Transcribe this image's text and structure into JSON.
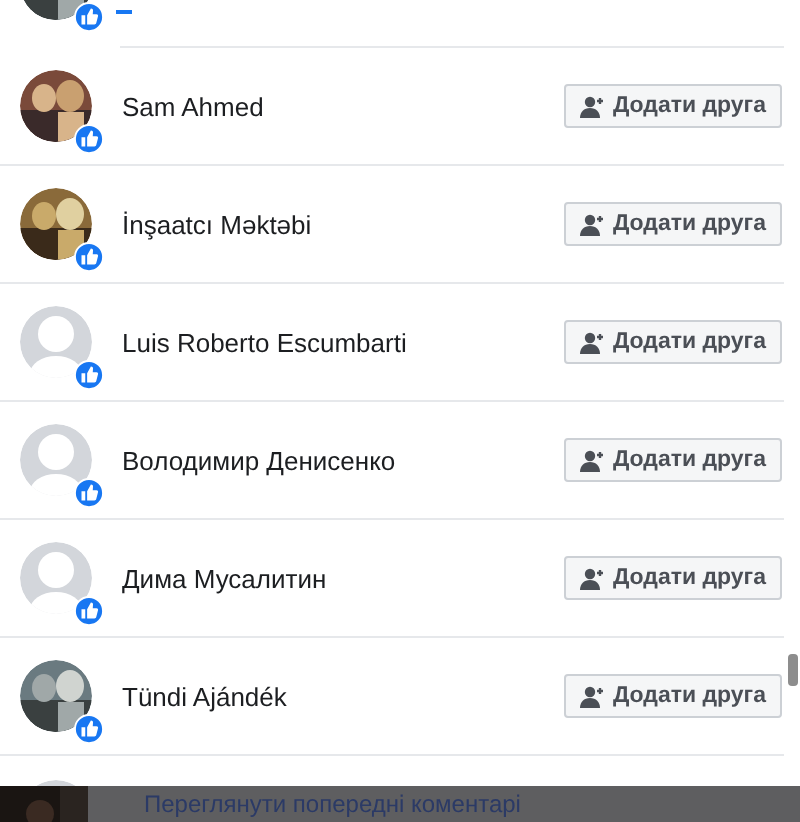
{
  "people": [
    {
      "name": "Sam Ahmed",
      "kind": "picture",
      "button": "Додати друга"
    },
    {
      "name": "İnşaatcı Məktəbi",
      "kind": "picture",
      "button": "Додати друга"
    },
    {
      "name": "Luis Roberto Escumbarti",
      "kind": "placeholder",
      "button": "Додати друга"
    },
    {
      "name": "Володимир Денисенко",
      "kind": "placeholder",
      "button": "Додати друга"
    },
    {
      "name": "Дима Мусалитин",
      "kind": "placeholder",
      "button": "Додати друга"
    },
    {
      "name": "Tündi Ajándék",
      "kind": "picture",
      "button": "Додати друга"
    }
  ],
  "footer": {
    "link": "Переглянути попередні коментарі"
  }
}
